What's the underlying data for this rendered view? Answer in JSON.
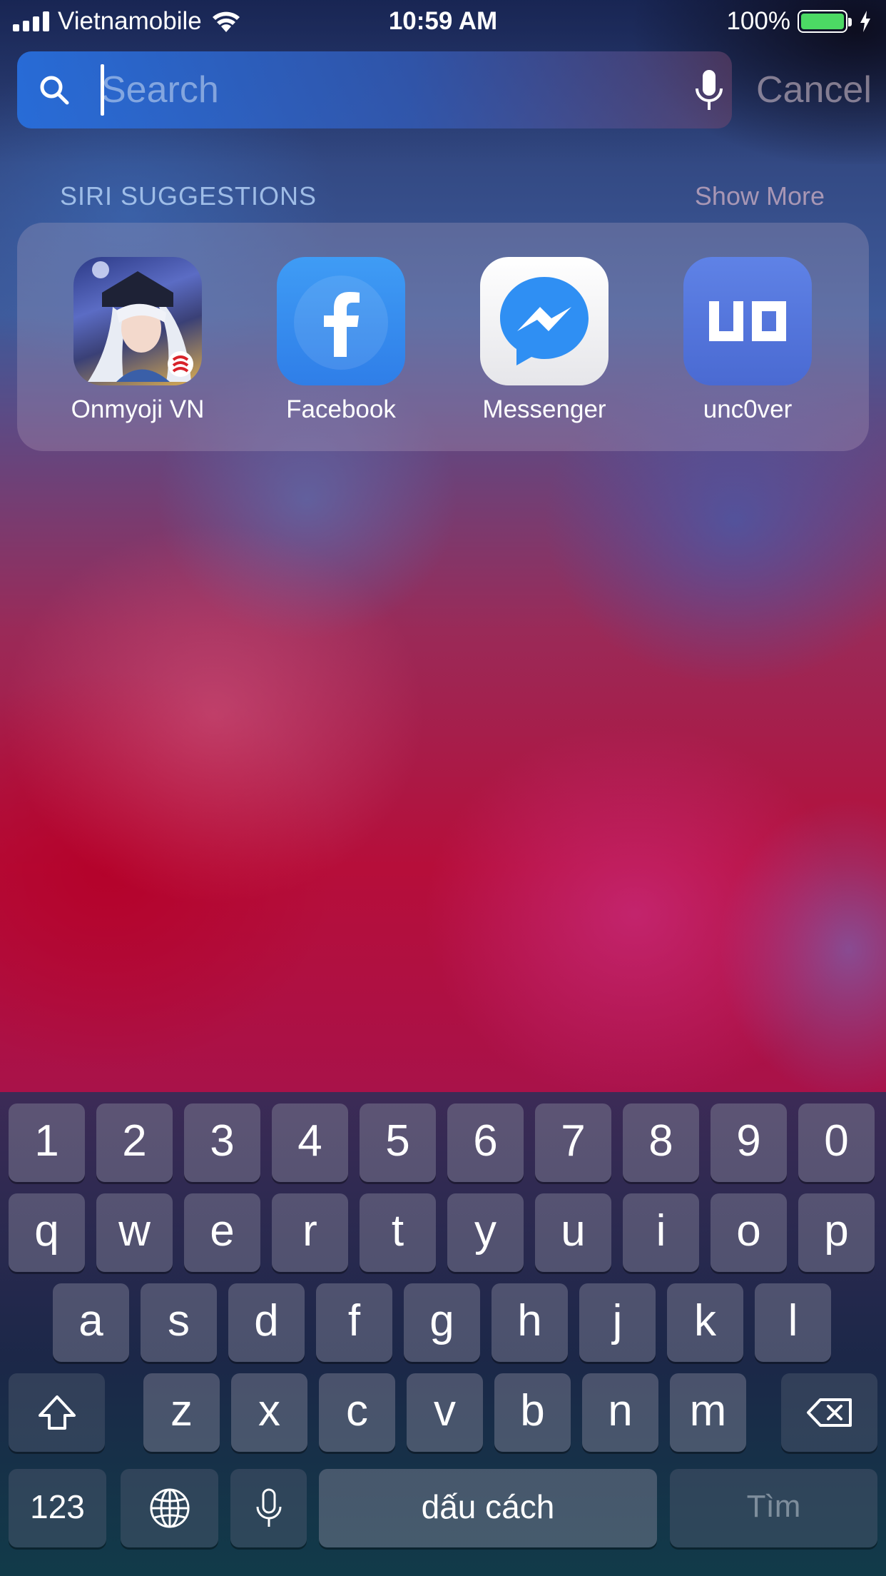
{
  "status_bar": {
    "carrier": "Vietnamobile",
    "time": "10:59 AM",
    "battery": "100%"
  },
  "search": {
    "placeholder": "Search",
    "value": "",
    "cancel_label": "Cancel"
  },
  "siri": {
    "header": "SIRI SUGGESTIONS",
    "show_more": "Show More",
    "apps": [
      {
        "label": "Onmyoji VN",
        "icon": "onmyoji-app-icon"
      },
      {
        "label": "Facebook",
        "icon": "facebook-app-icon"
      },
      {
        "label": "Messenger",
        "icon": "messenger-app-icon"
      },
      {
        "label": "unc0ver",
        "icon": "uncover-app-icon"
      }
    ]
  },
  "keyboard": {
    "row_numbers": [
      "1",
      "2",
      "3",
      "4",
      "5",
      "6",
      "7",
      "8",
      "9",
      "0"
    ],
    "row_top": [
      "q",
      "w",
      "e",
      "r",
      "t",
      "y",
      "u",
      "i",
      "o",
      "p"
    ],
    "row_mid": [
      "a",
      "s",
      "d",
      "f",
      "g",
      "h",
      "j",
      "k",
      "l"
    ],
    "row_bottom": [
      "z",
      "x",
      "c",
      "v",
      "b",
      "n",
      "m"
    ],
    "numbers_label": "123",
    "space_label": "dấu cách",
    "return_label": "Tìm"
  },
  "colors": {
    "battery_fill": "#4cd964",
    "search_field": "#2f6fd8",
    "facebook_blue": "#3b8ff0"
  }
}
